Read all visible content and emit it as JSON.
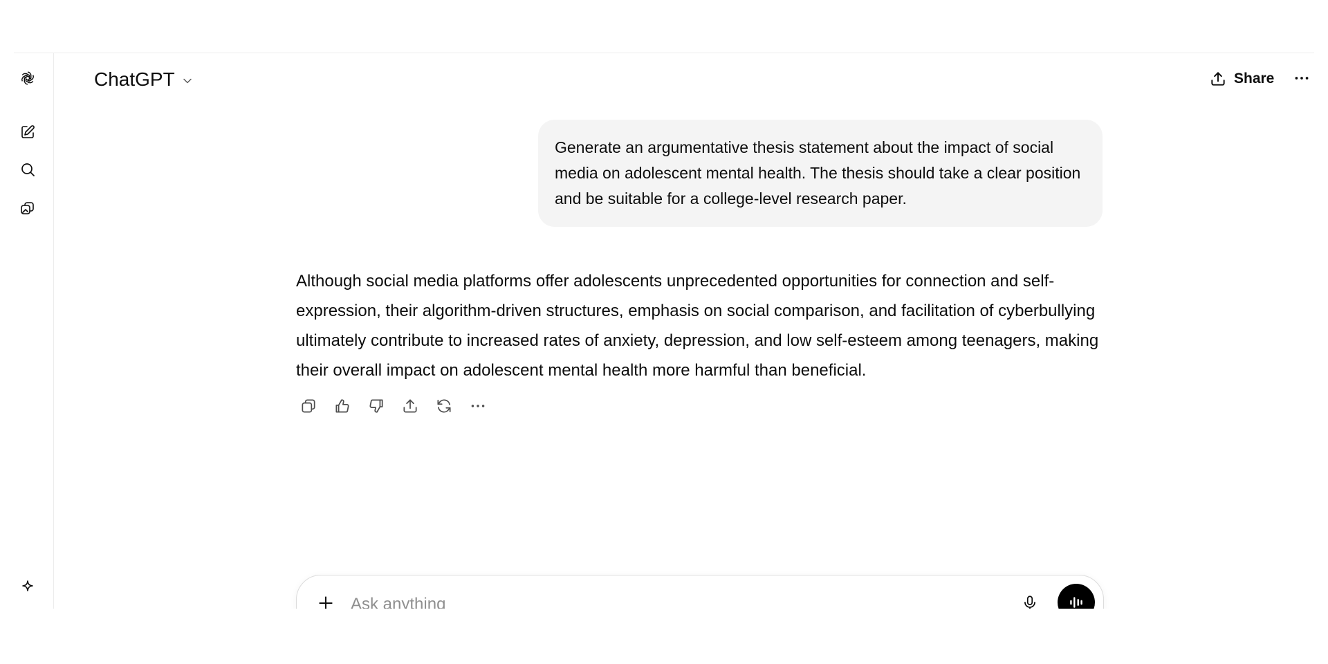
{
  "header": {
    "model_name": "ChatGPT",
    "share_label": "Share"
  },
  "sidebar": {
    "icons": [
      "openai-logo-icon",
      "new-chat-icon",
      "search-icon",
      "library-icon",
      "sparkle-icon"
    ]
  },
  "conversation": {
    "user_message": "Generate an argumentative thesis statement about the impact of social media on adolescent mental health. The thesis should take a clear position and be suitable for a college-level research paper.",
    "assistant_message": "Although social media platforms offer adolescents unprecedented opportunities for connection and self-expression, their algorithm-driven structures, emphasis on social comparison, and facilitation of cyberbullying ultimately contribute to increased rates of anxiety, depression, and low self-esteem among teenagers, making their overall impact on adolescent mental health more harmful than beneficial."
  },
  "message_actions": [
    "copy-icon",
    "thumbs-up-icon",
    "thumbs-down-icon",
    "share-icon",
    "regenerate-icon",
    "more-icon"
  ],
  "composer": {
    "placeholder": "Ask anything"
  }
}
